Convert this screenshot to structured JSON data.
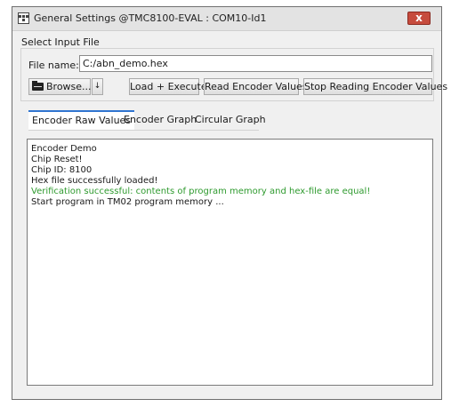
{
  "window": {
    "title": "General Settings @TMC8100-EVAL : COM10-Id1",
    "close_label": "x"
  },
  "select_input": {
    "label": "Select Input File",
    "file_name_label": "File name:",
    "file_name_value": "C:/abn_demo.hex",
    "browse_label": "Browse...",
    "dropdown_label": "↓",
    "load_label": "Load + Execute",
    "read_label": "Read Encoder Values",
    "stop_label": "Stop Reading Encoder Values"
  },
  "tabs": [
    {
      "label": "Encoder Raw Values",
      "active": true
    },
    {
      "label": "Encoder Graph",
      "active": false
    },
    {
      "label": "Circular Graph",
      "active": false
    }
  ],
  "log": [
    {
      "text": "Encoder Demo",
      "color": "#1a1a1a"
    },
    {
      "text": "Chip Reset!",
      "color": "#1a1a1a"
    },
    {
      "text": "Chip ID: 8100",
      "color": "#1a1a1a"
    },
    {
      "text": "Hex file successfully loaded!",
      "color": "#1a1a1a"
    },
    {
      "text": "Verification successful: contents of program memory and hex-file are equal!",
      "color": "#2e9a2e"
    },
    {
      "text": "Start program in TM02 program memory ...",
      "color": "#1a1a1a"
    }
  ],
  "colors": {
    "accent": "#2f74d0",
    "close_button": "#c64b3d",
    "success_text": "#2e9a2e"
  }
}
